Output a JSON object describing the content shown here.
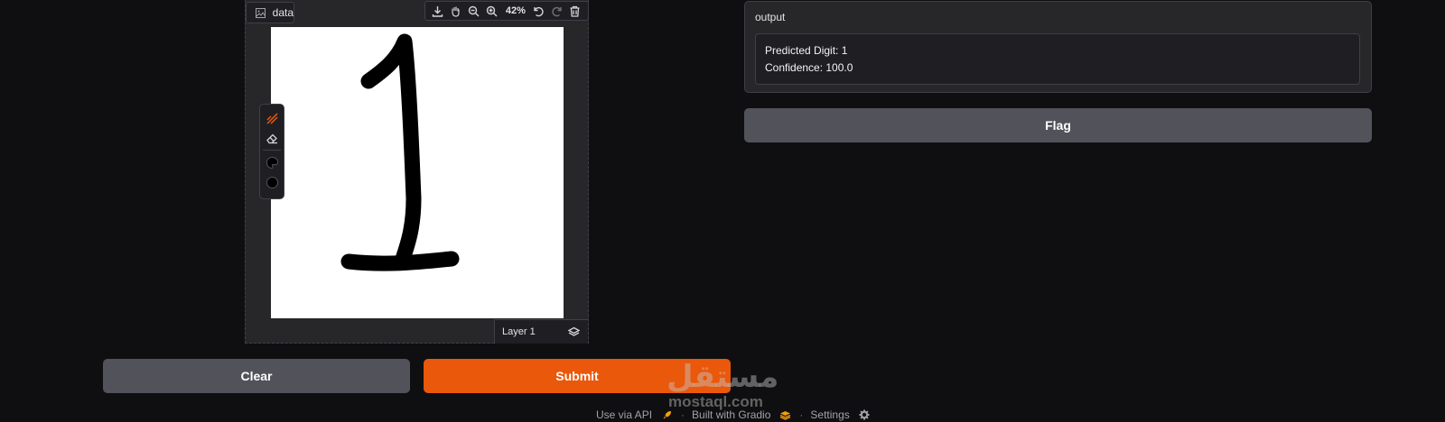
{
  "editor": {
    "label": "data",
    "zoom": "42%",
    "layer_label": "Layer 1",
    "drawn_digit": "1"
  },
  "buttons": {
    "clear": "Clear",
    "submit": "Submit",
    "flag": "Flag"
  },
  "output": {
    "label": "output",
    "line1": "Predicted Digit: 1",
    "line2": "Confidence: 100.0"
  },
  "footer": {
    "api": "Use via API",
    "built": "Built with Gradio",
    "settings": "Settings",
    "sep": "·"
  },
  "watermark": {
    "arabic": "مستقل",
    "latin": "mostaql.com"
  },
  "colors": {
    "background": "#0f0f11",
    "panel": "#27272a",
    "primary": "#ea580c",
    "secondary": "#52525b"
  },
  "icons": {
    "toolbar": [
      "download-icon",
      "pan-icon",
      "zoom-out-icon",
      "zoom-in-icon",
      "undo-icon",
      "redo-icon",
      "trash-icon"
    ],
    "side": [
      "brush-icon",
      "eraser-icon",
      "color-palette-icon",
      "brush-size-icon"
    ],
    "layers": "layers-icon"
  }
}
